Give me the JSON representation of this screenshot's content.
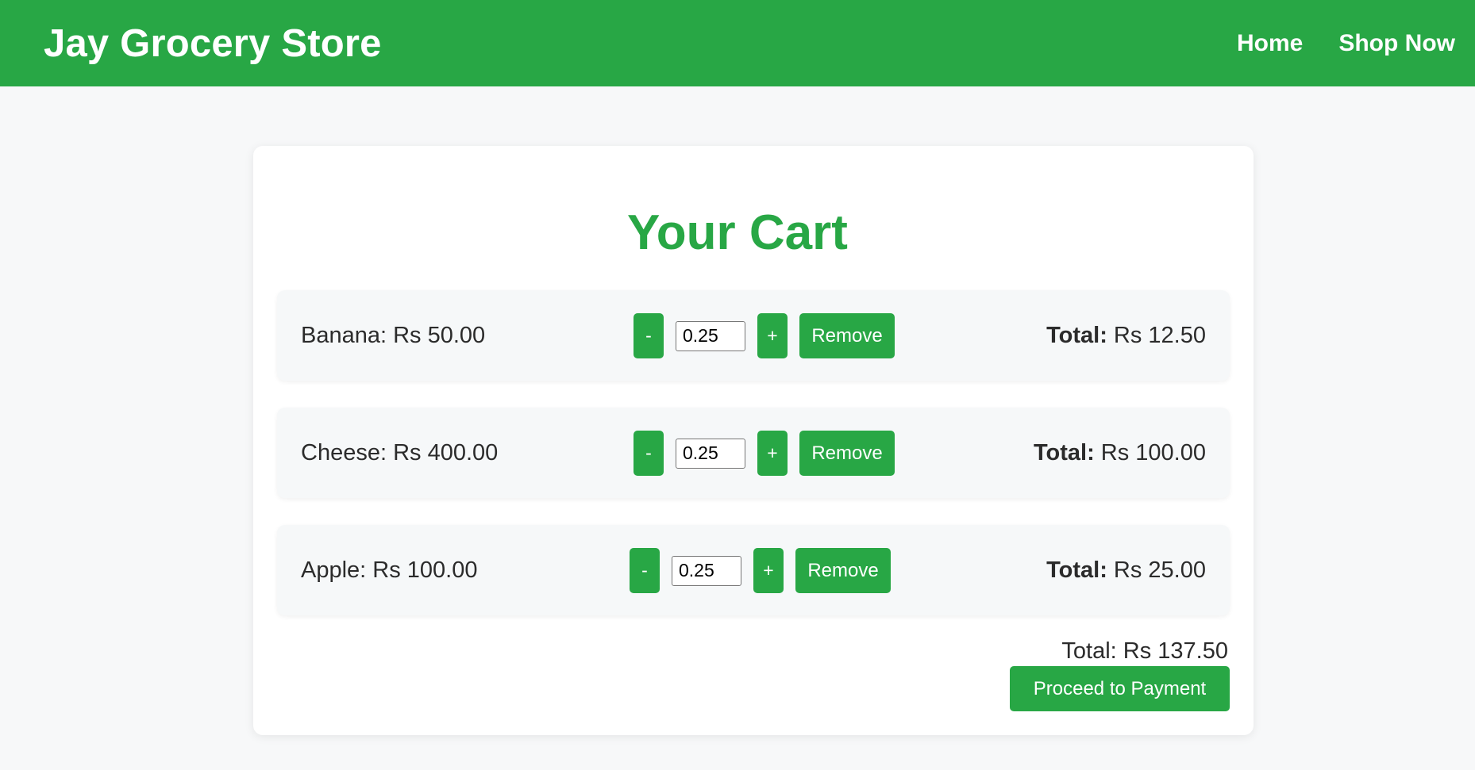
{
  "header": {
    "brand": "Jay Grocery Store",
    "nav": [
      {
        "label": "Home"
      },
      {
        "label": "Shop Now"
      }
    ]
  },
  "cart": {
    "title": "Your Cart",
    "items": [
      {
        "name_price": "Banana: Rs 50.00",
        "minus": "-",
        "qty": "0.25",
        "plus": "+",
        "remove": "Remove",
        "total_label": "Total:",
        "total_value": " Rs 12.50"
      },
      {
        "name_price": "Cheese: Rs 400.00",
        "minus": "-",
        "qty": "0.25",
        "plus": "+",
        "remove": "Remove",
        "total_label": "Total:",
        "total_value": " Rs 100.00"
      },
      {
        "name_price": "Apple: Rs 100.00",
        "minus": "-",
        "qty": "0.25",
        "plus": "+",
        "remove": "Remove",
        "total_label": "Total:",
        "total_value": " Rs 25.00"
      }
    ],
    "grand_total": "Total: Rs 137.50",
    "pay_button": "Proceed to Payment"
  },
  "colors": {
    "accent": "#28a745",
    "background": "#f7f8f9",
    "card": "#ffffff"
  }
}
